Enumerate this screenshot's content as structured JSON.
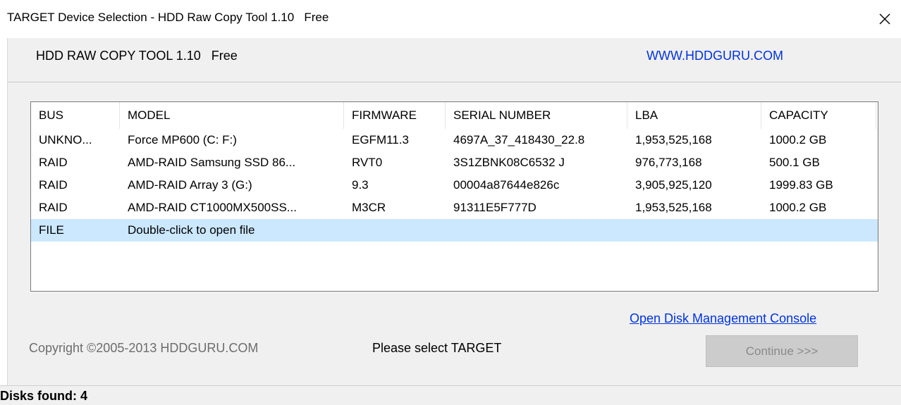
{
  "window": {
    "title": "TARGET Device Selection - HDD Raw Copy Tool 1.10   Free"
  },
  "header": {
    "app_name": "HDD RAW COPY TOOL 1.10   Free",
    "site_link": "WWW.HDDGURU.COM"
  },
  "disk_list": {
    "columns": [
      "BUS",
      "MODEL",
      "FIRMWARE",
      "SERIAL NUMBER",
      "LBA",
      "CAPACITY"
    ],
    "rows": [
      {
        "bus": "UNKNO...",
        "model": "Force MP600 (C: F:)",
        "firmware": "EGFM11.3",
        "serial": "4697A_37_418430_22.8",
        "lba": "1,953,525,168",
        "capacity": "1000.2 GB"
      },
      {
        "bus": "RAID",
        "model": "AMD-RAID Samsung SSD 86...",
        "firmware": "RVT0",
        "serial": "3S1ZBNK08C6532 J",
        "lba": "976,773,168",
        "capacity": "500.1 GB"
      },
      {
        "bus": "RAID",
        "model": "AMD-RAID Array 3 (G:)",
        "firmware": "9.3",
        "serial": "00004a87644e826c",
        "lba": "3,905,925,120",
        "capacity": "1999.83 GB"
      },
      {
        "bus": "RAID",
        "model": "AMD-RAID CT1000MX500SS...",
        "firmware": "M3CR",
        "serial": "91311E5F777D",
        "lba": "1,953,525,168",
        "capacity": "1000.2 GB"
      },
      {
        "bus": "FILE",
        "model": "Double-click to open file",
        "firmware": "",
        "serial": "",
        "lba": "",
        "capacity": ""
      }
    ],
    "selected_row_index": 4,
    "selection_color": "#cce8ff"
  },
  "footer": {
    "mgmt_link": "Open Disk Management Console",
    "copyright": "Copyright ©2005-2013 HDDGURU.COM",
    "prompt": "Please select TARGET",
    "continue_label": "Continue >>>",
    "continue_enabled": false
  },
  "status": {
    "text": "Disks found: 4"
  },
  "icons": {
    "close": "close-icon"
  },
  "colors": {
    "link": "#0033dd",
    "window_bg": "#f0f0f0"
  }
}
